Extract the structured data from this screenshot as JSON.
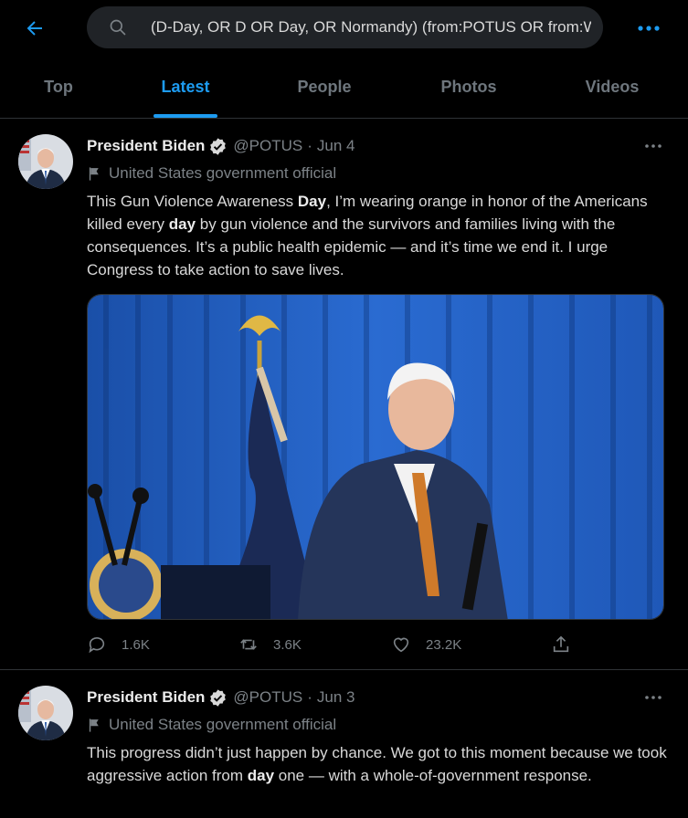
{
  "header": {
    "search_value": "(D-Day, OR D OR Day, OR Normandy) (from:POTUS OR from:WhiteHouse)",
    "back_icon": "arrow-left-icon",
    "more_icon": "more-horizontal-icon",
    "accent": "#1d9bf0"
  },
  "tabs": [
    {
      "label": "Top"
    },
    {
      "label": "Latest",
      "active": true
    },
    {
      "label": "People"
    },
    {
      "label": "Photos"
    },
    {
      "label": "Videos"
    }
  ],
  "tweets": [
    {
      "name": "President Biden",
      "handle": "@POTUS",
      "date": "Jun 4",
      "label": "United States government official",
      "text": [
        {
          "t": "This Gun Violence Awareness "
        },
        {
          "t": "Day",
          "b": true
        },
        {
          "t": ", I’m wearing orange in honor of the Americans killed every "
        },
        {
          "t": "day",
          "b": true
        },
        {
          "t": " by gun violence and the survivors and families living with the consequences. It’s a public health epidemic — and it’s time we end it. I urge Congress to take action to save lives."
        }
      ],
      "stats": {
        "replies": "1.6K",
        "retweets": "3.6K",
        "likes": "23.2K"
      }
    },
    {
      "name": "President Biden",
      "handle": "@POTUS",
      "date": "Jun 3",
      "label": "United States government official",
      "text": [
        {
          "t": "This progress didn’t just happen by chance. We got to this moment because we took aggressive action from "
        },
        {
          "t": "day",
          "b": true
        },
        {
          "t": " one — with a whole-of-government response."
        }
      ]
    }
  ]
}
